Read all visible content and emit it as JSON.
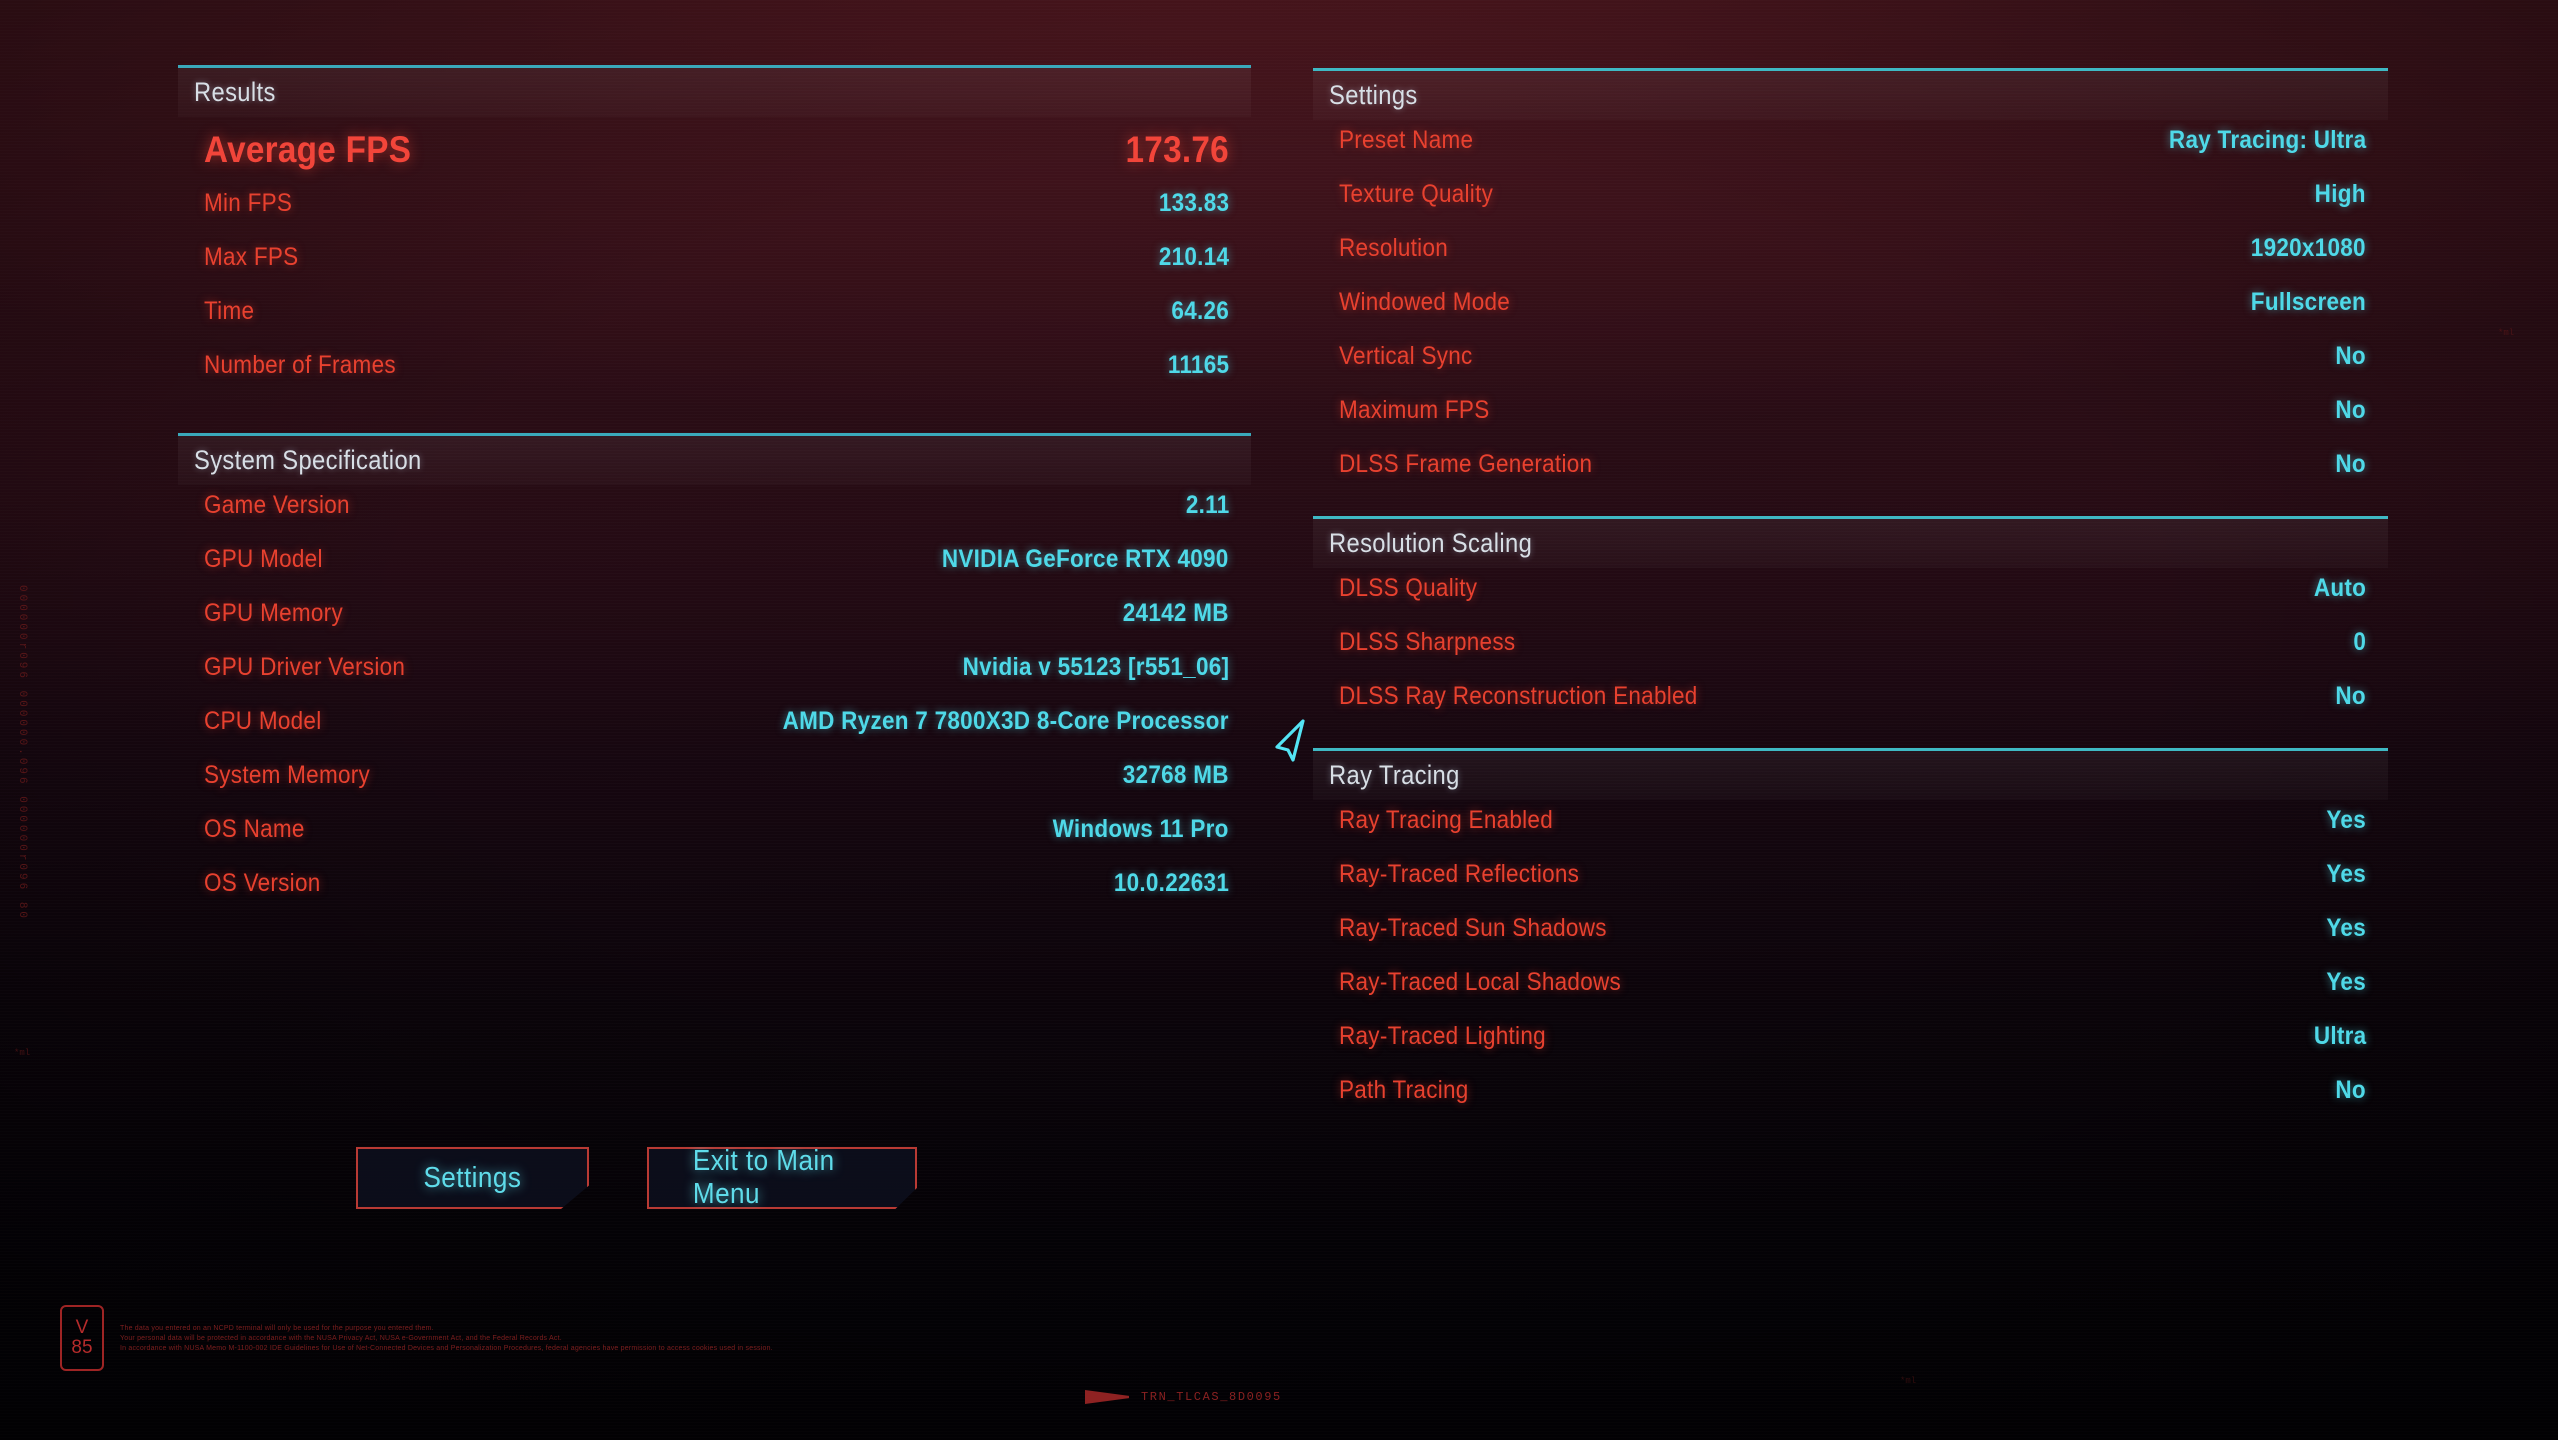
{
  "results": {
    "title": "Results",
    "hero": {
      "label": "Average FPS",
      "value": "173.76"
    },
    "rows": [
      {
        "label": "Min FPS",
        "value": "133.83"
      },
      {
        "label": "Max FPS",
        "value": "210.14"
      },
      {
        "label": "Time",
        "value": "64.26"
      },
      {
        "label": "Number of Frames",
        "value": "11165"
      }
    ]
  },
  "system_specification": {
    "title": "System Specification",
    "rows": [
      {
        "label": "Game Version",
        "value": "2.11"
      },
      {
        "label": "GPU Model",
        "value": "NVIDIA GeForce RTX 4090"
      },
      {
        "label": "GPU Memory",
        "value": "24142 MB"
      },
      {
        "label": "GPU Driver Version",
        "value": "Nvidia v 55123 [r551_06]"
      },
      {
        "label": "CPU Model",
        "value": "AMD Ryzen 7 7800X3D 8-Core Processor"
      },
      {
        "label": "System Memory",
        "value": "32768 MB"
      },
      {
        "label": "OS Name",
        "value": "Windows 11 Pro"
      },
      {
        "label": "OS Version",
        "value": "10.0.22631"
      }
    ]
  },
  "settings": {
    "title": "Settings",
    "rows": [
      {
        "label": "Preset Name",
        "value": "Ray Tracing: Ultra"
      },
      {
        "label": "Texture Quality",
        "value": "High"
      },
      {
        "label": "Resolution",
        "value": "1920x1080"
      },
      {
        "label": "Windowed Mode",
        "value": "Fullscreen"
      },
      {
        "label": "Vertical Sync",
        "value": "No"
      },
      {
        "label": "Maximum FPS",
        "value": "No"
      },
      {
        "label": "DLSS Frame Generation",
        "value": "No"
      }
    ]
  },
  "resolution_scaling": {
    "title": "Resolution Scaling",
    "rows": [
      {
        "label": "DLSS Quality",
        "value": "Auto"
      },
      {
        "label": "DLSS Sharpness",
        "value": "0"
      },
      {
        "label": "DLSS Ray Reconstruction Enabled",
        "value": "No"
      }
    ]
  },
  "ray_tracing": {
    "title": "Ray Tracing",
    "rows": [
      {
        "label": "Ray Tracing Enabled",
        "value": "Yes"
      },
      {
        "label": "Ray-Traced Reflections",
        "value": "Yes"
      },
      {
        "label": "Ray-Traced Sun Shadows",
        "value": "Yes"
      },
      {
        "label": "Ray-Traced Local Shadows",
        "value": "Yes"
      },
      {
        "label": "Ray-Traced Lighting",
        "value": "Ultra"
      },
      {
        "label": "Path Tracing",
        "value": "No"
      }
    ]
  },
  "buttons": {
    "settings_label": "Settings",
    "exit_label": "Exit to Main Menu"
  },
  "decor": {
    "vertical_code": "000000r096 000000.096 000000r096 80",
    "tiny_left": "*ml",
    "tiny_right": "*ml",
    "tiny_right2": "*ml",
    "badge_line1": "V",
    "badge_line2": "85",
    "legal": [
      "The data you entered on an NCPD terminal will only be used for the purpose you entered them.",
      "Your personal data will be protected in accordance with the NUSA Privacy Act, NUSA e-Government Act, and the Federal Records Act.",
      "In accordance with NUSA Memo M-1100-002 IDE Guidelines for Use of Net-Connected Devices and Personalization Procedures, federal agencies have permission to access cookies used in session."
    ],
    "trn_code": "TRN_TLCAS_8D0095"
  },
  "colors": {
    "accent_cyan": "#4fd9e8",
    "accent_red": "#e8412f",
    "header_teal": "#3fb9c4",
    "button_border": "#b93a34"
  }
}
